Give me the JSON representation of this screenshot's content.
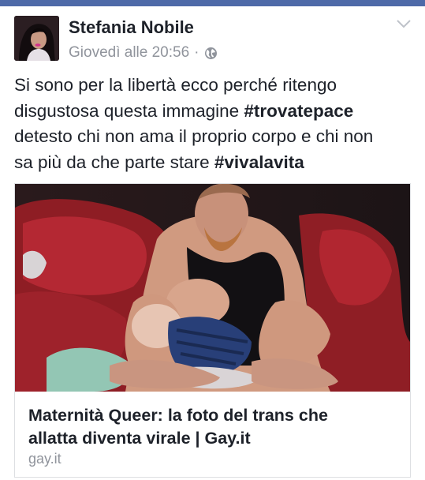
{
  "post": {
    "author_name": "Stefania Nobile",
    "timestamp": "Giovedì alle 20:56",
    "separator": "·",
    "audience_icon": "globe-icon",
    "options_icon": "chevron-down-icon",
    "text_lines": [
      {
        "plain": "Si sono per la libertà ecco perché ritengo",
        "hashtag": ""
      },
      {
        "plain": "disgustosa questa immagine ",
        "hashtag": "#trovatepace"
      },
      {
        "plain": "detesto chi non ama il proprio corpo e chi non",
        "hashtag": ""
      },
      {
        "plain": "sa più da che parte stare ",
        "hashtag": "#vivalavita"
      }
    ]
  },
  "link_preview": {
    "title_lines": [
      "Maternità Queer: la foto del trans che",
      "allatta diventa virale | Gay.it"
    ],
    "domain": "gay.it"
  },
  "colors": {
    "top_strip": "#4e6aa8",
    "name_text": "#1d2129",
    "secondary_text": "#90949c",
    "card_border": "#dddfe2"
  }
}
